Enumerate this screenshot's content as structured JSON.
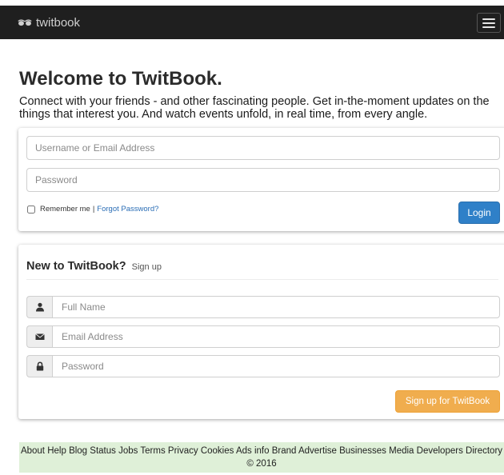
{
  "navbar": {
    "brand": "twitbook",
    "brand_icon": "glasses-icon",
    "menu_icon": "hamburger-icon",
    "background": "#1f1f1f"
  },
  "hero": {
    "title": "Welcome to TwitBook.",
    "tagline": "Connect with your friends - and other fascinating people. Get in-the-moment updates on the things that interest you. And watch events unfold, in real time, from every angle."
  },
  "login": {
    "username_placeholder": "Username or Email Address",
    "password_placeholder": "Password",
    "remember_label": "Remember me",
    "separator": "|",
    "forgot_label": "Forgot Password?",
    "login_button": "Login",
    "login_color": "#2f80c8"
  },
  "signup": {
    "heading": "New to TwitBook?",
    "subheading": "Sign up",
    "fields": [
      {
        "icon": "user-icon",
        "placeholder": "Full Name"
      },
      {
        "icon": "envelope-icon",
        "placeholder": "Email Address"
      },
      {
        "icon": "lock-icon",
        "placeholder": "Password"
      }
    ],
    "submit_button": "Sign up for TwitBook",
    "submit_color": "#f0ad4e"
  },
  "footer": {
    "links": [
      "About",
      "Help",
      "Blog",
      "Status",
      "Jobs",
      "Terms",
      "Privacy",
      "Cookies",
      "Ads info",
      "Brand",
      "Advertise",
      "Businesses",
      "Media",
      "Developers",
      "Directory"
    ],
    "copyright": "© 2016",
    "background": "#dff0d8"
  }
}
